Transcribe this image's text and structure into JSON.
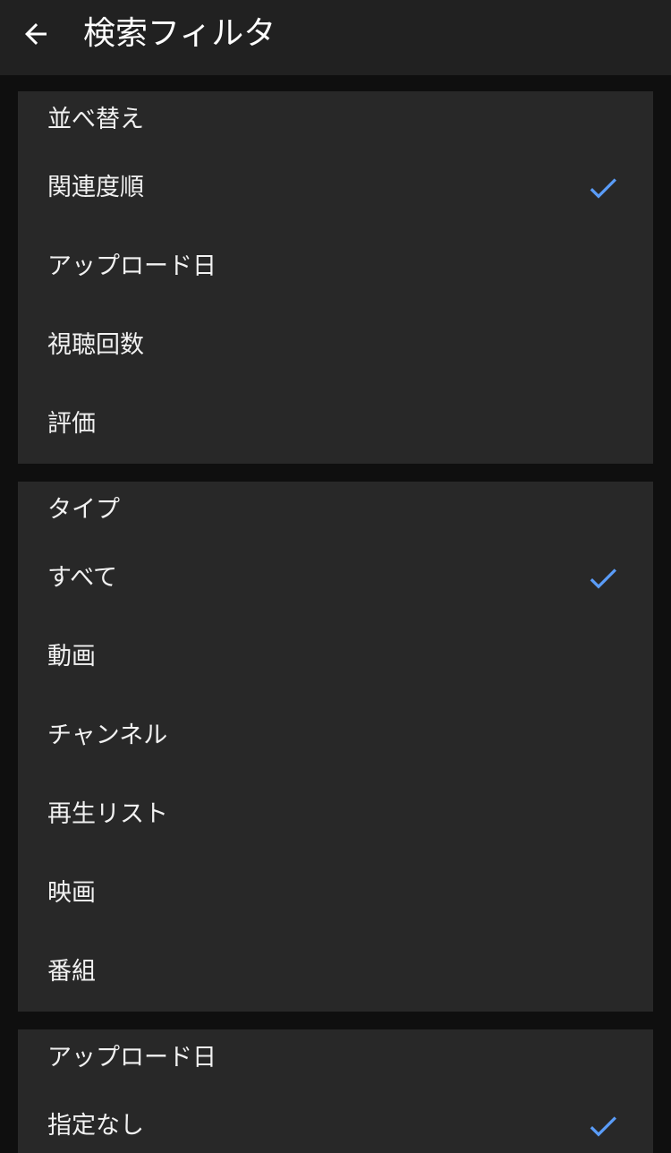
{
  "header": {
    "title": "検索フィルタ"
  },
  "colors": {
    "accent": "#5a9cf8",
    "app_bar": "#212121",
    "surface": "#282828",
    "background": "#0f0f0f",
    "text": "#f1f1f1"
  },
  "icons": {
    "back": "arrow-left-icon",
    "selected": "checkmark-icon"
  },
  "sections": [
    {
      "title": "並べ替え",
      "options": [
        {
          "label": "関連度順",
          "selected": true
        },
        {
          "label": "アップロード日",
          "selected": false
        },
        {
          "label": "視聴回数",
          "selected": false
        },
        {
          "label": "評価",
          "selected": false
        }
      ]
    },
    {
      "title": "タイプ",
      "options": [
        {
          "label": "すべて",
          "selected": true
        },
        {
          "label": "動画",
          "selected": false
        },
        {
          "label": "チャンネル",
          "selected": false
        },
        {
          "label": "再生リスト",
          "selected": false
        },
        {
          "label": "映画",
          "selected": false
        },
        {
          "label": "番組",
          "selected": false
        }
      ]
    },
    {
      "title": "アップロード日",
      "options": [
        {
          "label": "指定なし",
          "selected": true
        }
      ]
    }
  ]
}
